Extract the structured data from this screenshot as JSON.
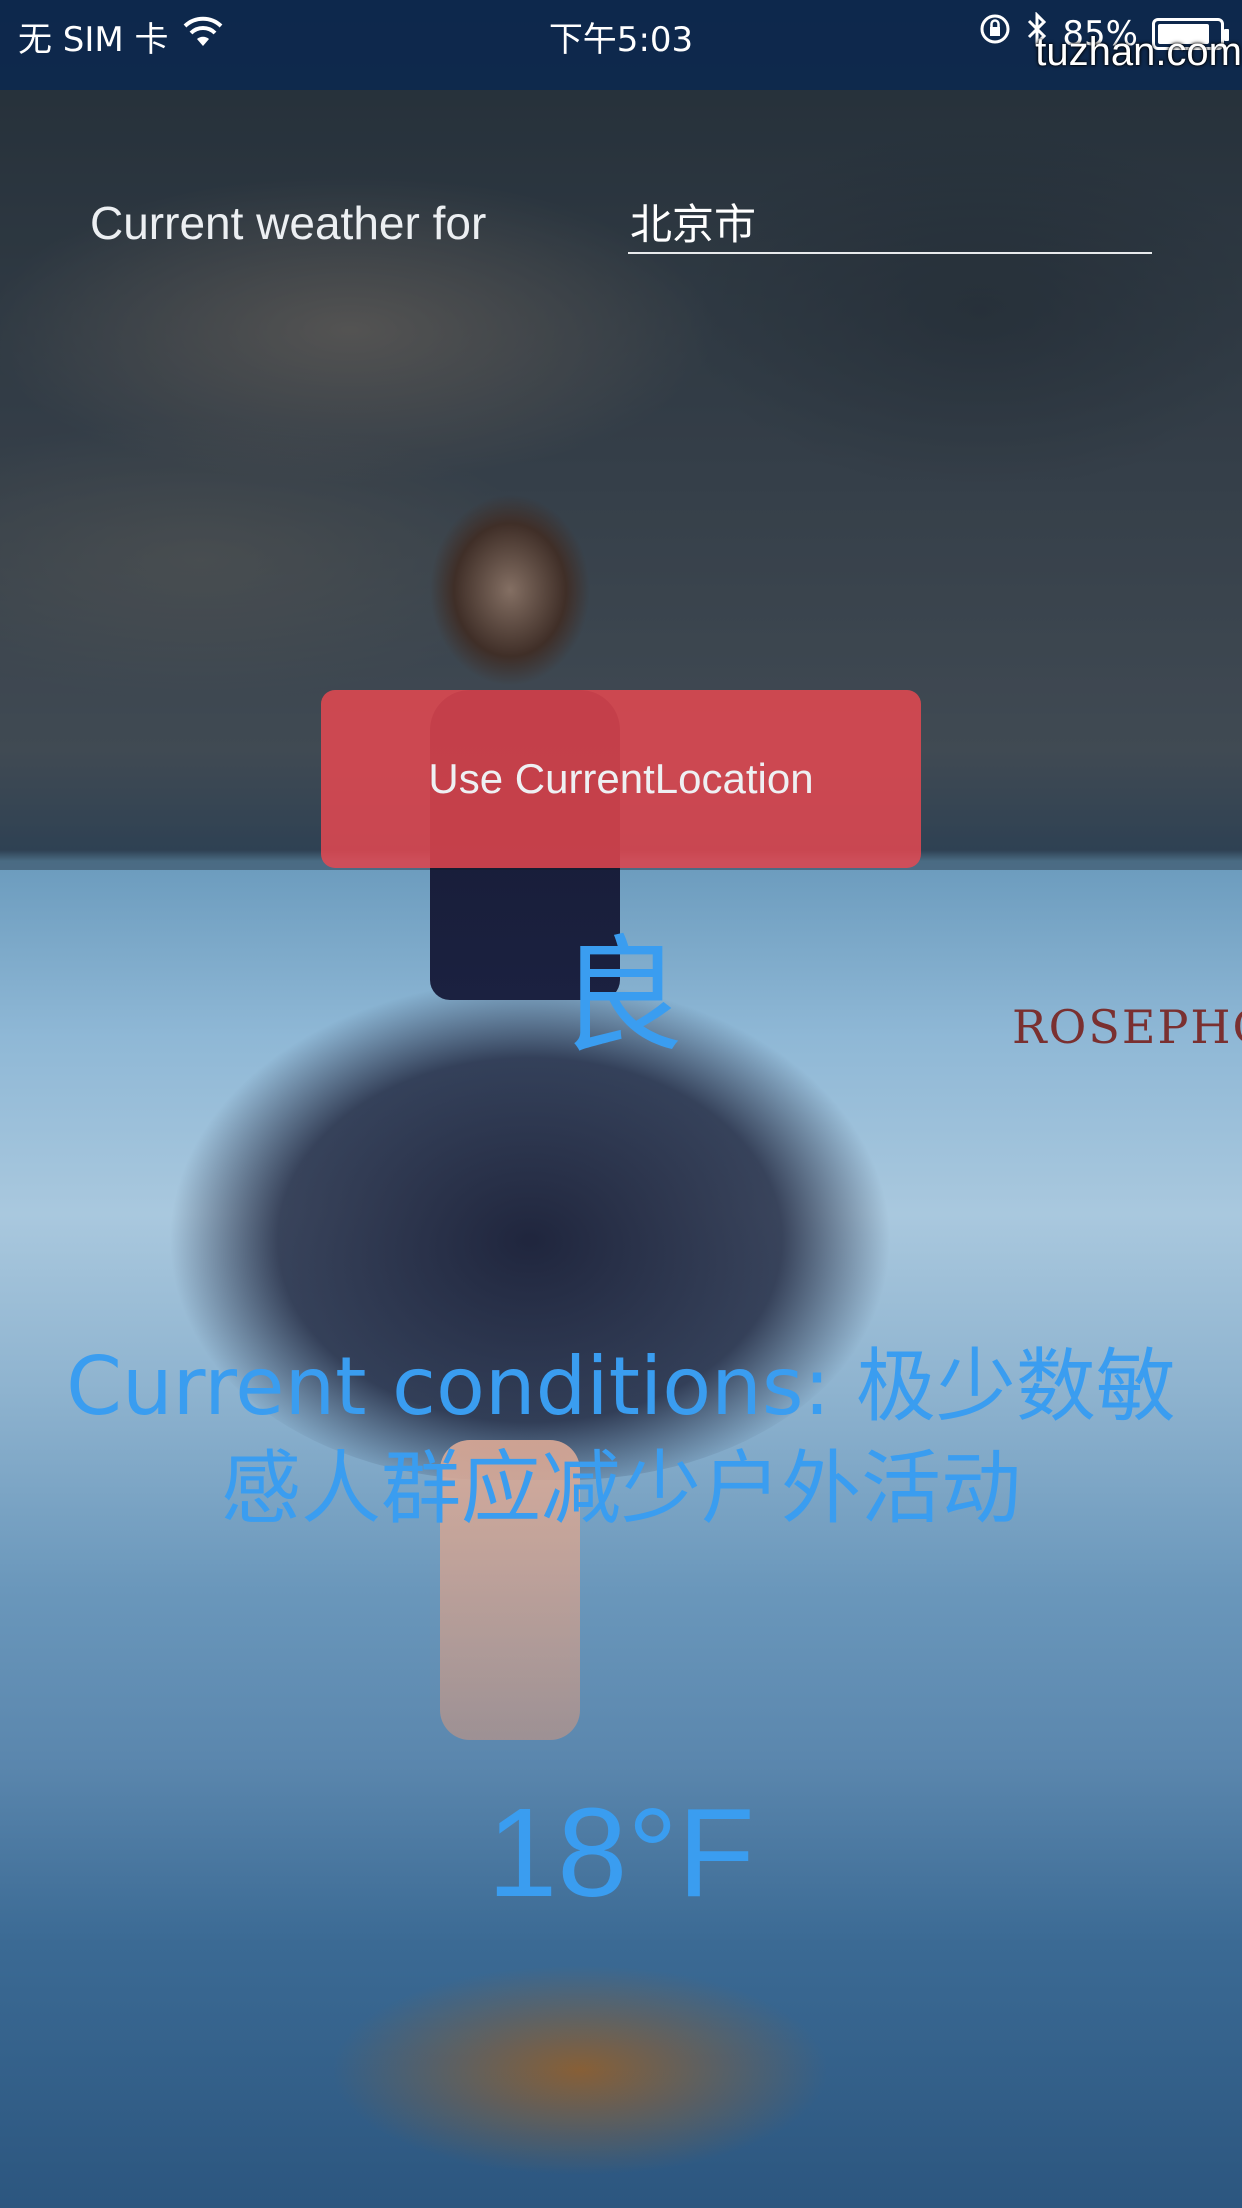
{
  "status_bar": {
    "carrier": "无 SIM 卡",
    "time": "下午5:03",
    "battery": "85%",
    "battery_level": 0.85
  },
  "watermarks": {
    "corner": "tuzhan.com",
    "photo_text": "ROSEPHO"
  },
  "header": {
    "label": "Current weather for",
    "city_value": "北京市"
  },
  "location_button": {
    "label": "Use CurrentLocation"
  },
  "weather": {
    "aqi_level": "良",
    "conditions": "Current conditions: 极少数敏感人群应减少户外活动",
    "temperature": "18°F"
  },
  "colors": {
    "accent_text": "#3a9df0",
    "button_bg": "#ec4850",
    "status_bar_bg": "#0c284e"
  },
  "icons": {
    "wifi": "wifi-icon",
    "orientation_lock": "orientation-lock-icon",
    "bluetooth": "bluetooth-icon",
    "battery": "battery-icon"
  }
}
